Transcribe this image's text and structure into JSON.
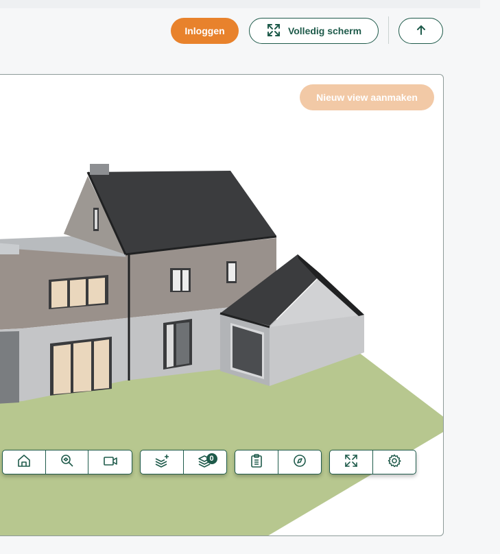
{
  "header": {
    "login_label": "Inloggen",
    "fullscreen_label": "Volledig scherm"
  },
  "viewer": {
    "new_view_label": "Nieuw view aanmaken",
    "layers_badge": "0"
  },
  "colors": {
    "accent_orange": "#e8822c",
    "accent_orange_light": "#f2c9a6",
    "brand_green": "#1e5a4a",
    "lawn": "#b6c78e",
    "roof": "#3a3b3d"
  },
  "toolbar": {
    "icons": [
      "home-icon",
      "zoom-icon",
      "camera-icon",
      "add-layer-icon",
      "layers-icon",
      "clipboard-icon",
      "compass-icon",
      "fullscreen-icon",
      "settings-icon"
    ]
  }
}
